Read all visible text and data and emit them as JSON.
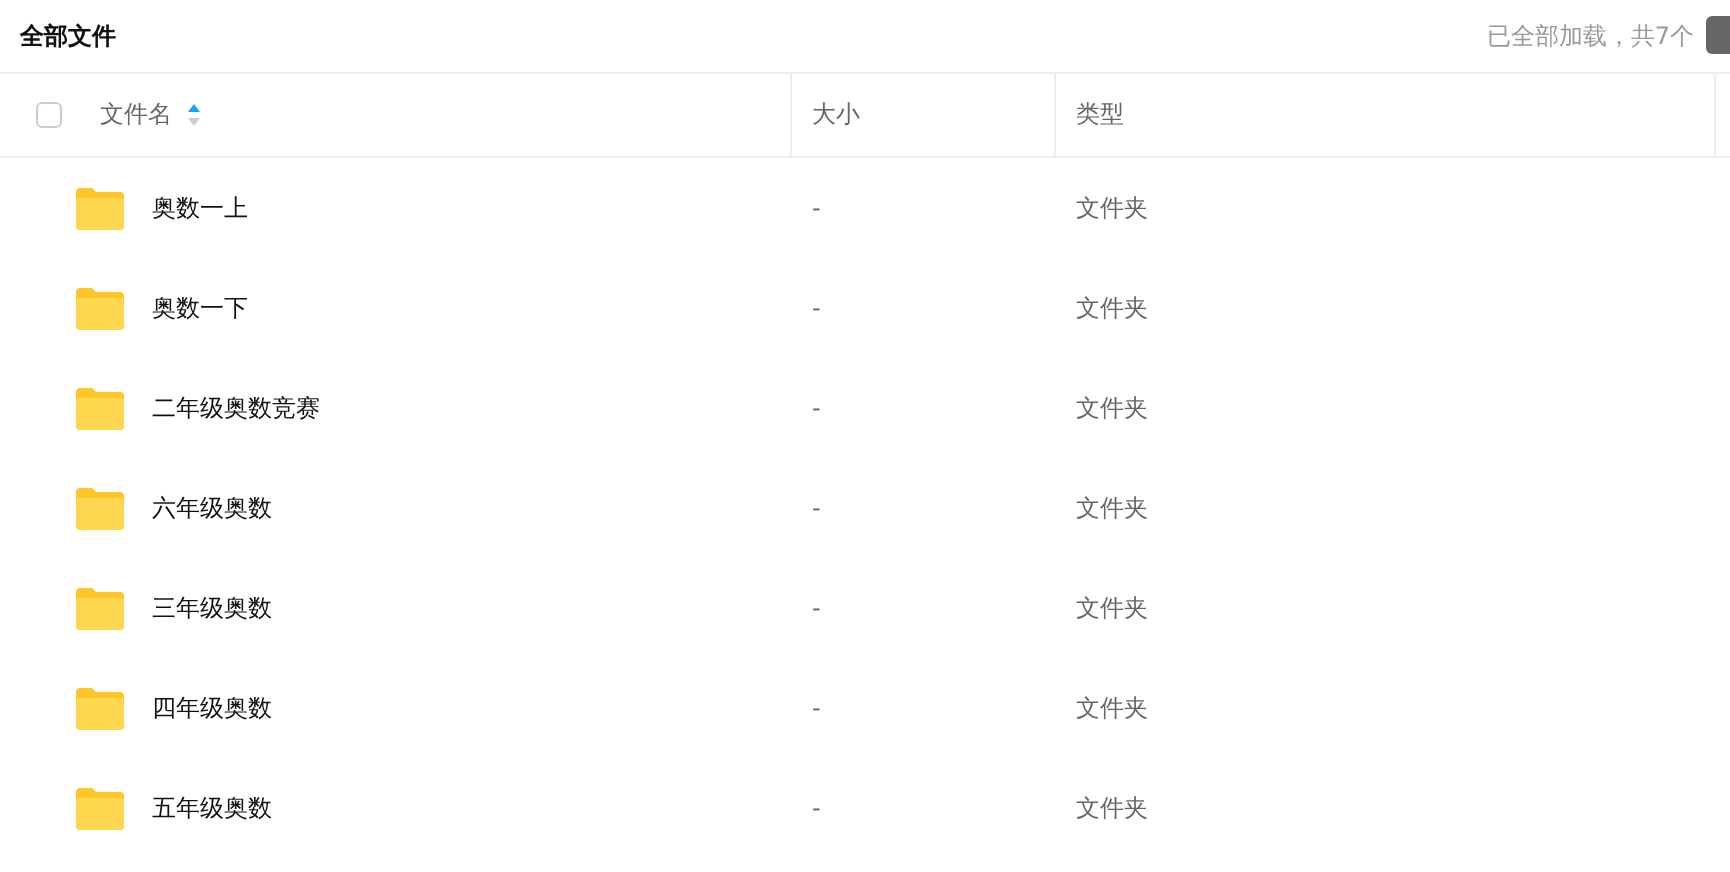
{
  "title": "全部文件",
  "status": "已全部加载，共7个",
  "select_all": {
    "checked": false
  },
  "columns": [
    {
      "label": "文件名",
      "sorted": true
    },
    {
      "label": "大小",
      "sorted": false
    },
    {
      "label": "类型",
      "sorted": false
    }
  ],
  "rows": [
    {
      "name": "奥数一上",
      "size": "-",
      "type": "文件夹"
    },
    {
      "name": "奥数一下",
      "size": "-",
      "type": "文件夹"
    },
    {
      "name": "二年级奥数竞赛",
      "size": "-",
      "type": "文件夹"
    },
    {
      "name": "六年级奥数",
      "size": "-",
      "type": "文件夹"
    },
    {
      "name": "三年级奥数",
      "size": "-",
      "type": "文件夹"
    },
    {
      "name": "四年级奥数",
      "size": "-",
      "type": "文件夹"
    },
    {
      "name": "五年级奥数",
      "size": "-",
      "type": "文件夹"
    }
  ]
}
